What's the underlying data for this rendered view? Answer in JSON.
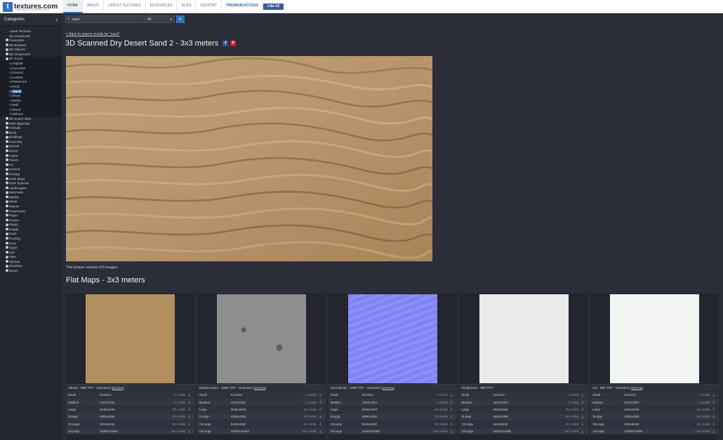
{
  "brand": {
    "logo_letter": "t",
    "name": "textures.com",
    "sub": "formerly CGTextures.com"
  },
  "nav": [
    {
      "label": "HOME",
      "active": true
    },
    {
      "label": "ABOUT"
    },
    {
      "label": "LATEST TEXTURES"
    },
    {
      "label": "RESOURCES"
    },
    {
      "label": "BLOG"
    },
    {
      "label": "SUPPORT"
    },
    {
      "label": "PREMIUM ACCESS",
      "premium": true
    }
  ],
  "fb_like": "Like 16",
  "sidebar": {
    "title": "Categories",
    "collapse_icon": "chevron-left-icon",
    "items": [
      {
        "label": "Latest Textures",
        "type": "plain"
      },
      {
        "label": "My Downloads",
        "type": "plain"
      },
      {
        "label": "Favourites",
        "type": "cat"
      },
      {
        "label": "3D Brushes",
        "type": "cat"
      },
      {
        "label": "3D Objects",
        "type": "cat"
      },
      {
        "label": "3D Ornaments",
        "type": "cat"
      },
      {
        "label": "3D Scans",
        "type": "cat",
        "selected": true
      },
      {
        "label": "Asphalt",
        "type": "sub",
        "selected": true
      },
      {
        "label": "Concrete",
        "type": "sub",
        "selected": true
      },
      {
        "label": "Ground",
        "type": "sub",
        "selected": true
      },
      {
        "label": "Leather",
        "type": "sub",
        "selected": true
      },
      {
        "label": "Pavement",
        "type": "sub",
        "selected": true
      },
      {
        "label": "Rock",
        "type": "sub",
        "selected": true
      },
      {
        "label": "Sand",
        "type": "sub",
        "selected": true,
        "current": true
      },
      {
        "label": "Snow",
        "type": "sub",
        "selected": true
      },
      {
        "label": "Stone",
        "type": "sub",
        "selected": true
      },
      {
        "label": "Wall",
        "type": "sub",
        "selected": true
      },
      {
        "label": "Wood",
        "type": "sub",
        "selected": true
      },
      {
        "label": "Various",
        "type": "sub",
        "selected": true
      },
      {
        "label": "3D Scans Atlas",
        "type": "cat"
      },
      {
        "label": "PBR Materials",
        "type": "cat"
      },
      {
        "label": "Animals",
        "type": "cat"
      },
      {
        "label": "Brick",
        "type": "cat"
      },
      {
        "label": "Buildings",
        "type": "cat"
      },
      {
        "label": "Concrete",
        "type": "cat"
      },
      {
        "label": "Decals",
        "type": "cat"
      },
      {
        "label": "Doors",
        "type": "cat"
      },
      {
        "label": "Fabric",
        "type": "cat"
      },
      {
        "label": "Floors",
        "type": "cat"
      },
      {
        "label": "FX",
        "type": "cat"
      },
      {
        "label": "Ground",
        "type": "cat"
      },
      {
        "label": "Grunge",
        "type": "cat"
      },
      {
        "label": "HDR Skies",
        "type": "cat"
      },
      {
        "label": "HDR Spheres",
        "type": "cat"
      },
      {
        "label": "Landscapes",
        "type": "cat"
      },
      {
        "label": "Manmade",
        "type": "cat"
      },
      {
        "label": "Marble",
        "type": "cat"
      },
      {
        "label": "Metal",
        "type": "cat"
      },
      {
        "label": "Nature",
        "type": "cat"
      },
      {
        "label": "Ornaments",
        "type": "cat"
      },
      {
        "label": "Paper",
        "type": "cat"
      },
      {
        "label": "Plaster",
        "type": "cat"
      },
      {
        "label": "Plastic",
        "type": "cat"
      },
      {
        "label": "Roads",
        "type": "cat"
      },
      {
        "label": "Rock",
        "type": "cat"
      },
      {
        "label": "Roofing",
        "type": "cat"
      },
      {
        "label": "Rust",
        "type": "cat"
      },
      {
        "label": "Signs",
        "type": "cat"
      },
      {
        "label": "Soil",
        "type": "cat"
      },
      {
        "label": "Tiles",
        "type": "cat"
      },
      {
        "label": "Various",
        "type": "cat"
      },
      {
        "label": "Windows",
        "type": "cat"
      },
      {
        "label": "Wood",
        "type": "cat"
      }
    ]
  },
  "search": {
    "query": "sand",
    "filter": "All",
    "filter_icon": "chevron-down-icon",
    "button_icon": "search-icon"
  },
  "back_link": "< Back to search results for \"sand\"",
  "page_title": "3D Scanned Dry Desert Sand 2 - 3x3 meters",
  "share": {
    "facebook": "f",
    "pinterest": "P"
  },
  "consists_text": "This texture consists of 6 images:",
  "section_title": "Flat Maps - 3x3 meters",
  "maps": [
    {
      "label": "Albedo - 8Bit TIFF - Seamless",
      "preview": "preview",
      "color": "#b38e5f"
    },
    {
      "label": "Displacement - 16Bit TIFF - Seamless",
      "preview": "preview",
      "color": "#8e8e8e"
    },
    {
      "label": "Normalmap - 16Bit TIFF - Seamless",
      "preview": "preview",
      "color": "#7f85f5"
    },
    {
      "label": "Roughness - 8Bit TIFF",
      "preview": "",
      "color": "#ebebeb"
    },
    {
      "label": "AO - 8Bit TIFF - Seamless",
      "preview": "preview",
      "color": "#f2f3f3"
    }
  ],
  "sizes": [
    {
      "name": "Small",
      "dim": "512x512",
      "credits": "1 credits"
    },
    {
      "name": "Medium",
      "dim": "1024x1024",
      "credits": "1 credits"
    },
    {
      "name": "Large",
      "dim": "2048x2048",
      "credits": "25 credits"
    },
    {
      "name": "XLarge",
      "dim": "4096x4096",
      "credits": "40 credits"
    },
    {
      "name": "XXLarge",
      "dim": "8192x8192",
      "credits": "80 credits"
    },
    {
      "name": "XXLarge",
      "dim": "16384x16384",
      "credits": "160 credits"
    }
  ]
}
